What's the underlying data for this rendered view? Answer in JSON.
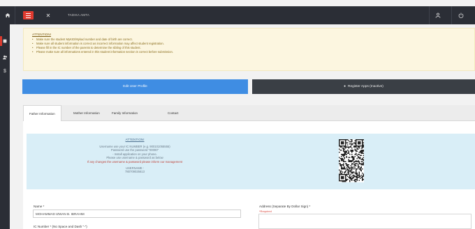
{
  "topbar": {
    "title": "TADIKA AMTA",
    "home_icon": "home-icon",
    "menu_icon": "hamburger-icon",
    "close_icon": "close-icon",
    "user_icon": "user-icon",
    "power_icon": "power-icon"
  },
  "sidebar": {
    "items": [
      {
        "icon": "list-icon"
      },
      {
        "icon": "users-icon"
      },
      {
        "icon": "dollar-icon"
      }
    ]
  },
  "notice": {
    "title": "ATTENTION!",
    "items": [
      "Make sure the student MyKID/Mykad number and date of birth are correct.",
      "Make sure all student information is correct as incorrect information may affect student registration.",
      "Please fill in the IC number of the parents to determine the sibling of this student.",
      "Please make sure all informations entered in this student information section is correct before submission."
    ]
  },
  "actions": {
    "profile_label": "Edit User Profile",
    "register_label": "Register Apps (Inactive)"
  },
  "tabs": [
    {
      "label": "Father Information",
      "active": true
    },
    {
      "label": "Mother Information",
      "active": false
    },
    {
      "label": "Family Information",
      "active": false
    },
    {
      "label": "Contact",
      "active": false
    }
  ],
  "attention": {
    "title": "ATTENTION!",
    "lines": [
      "Username use your IC NUMBER (e.g. 900101055555)",
      "Password use the password \"00000\"",
      "- Install application on your phone.",
      "Please use username & password as below",
      "If any changes the username & password please inform our management"
    ],
    "username_label": "USERNAME :",
    "username_value": "780709025613"
  },
  "form": {
    "name_label": "Name *",
    "name_value": "MOHAMMAD IZWAN B. IBRAHIM",
    "ic_label": "IC Number * (No Space and Dash \"-\")",
    "address_label": "Address (Separate By Dollar Sign) *",
    "address_hint": "*Required"
  },
  "colors": {
    "topbar": "#2b2e36",
    "accent_red": "#e03a2f",
    "primary_blue": "#3f8de3",
    "dark_button": "#3a3f45",
    "notice_bg": "#fcf6e0",
    "info_bg": "#d9eef7"
  }
}
